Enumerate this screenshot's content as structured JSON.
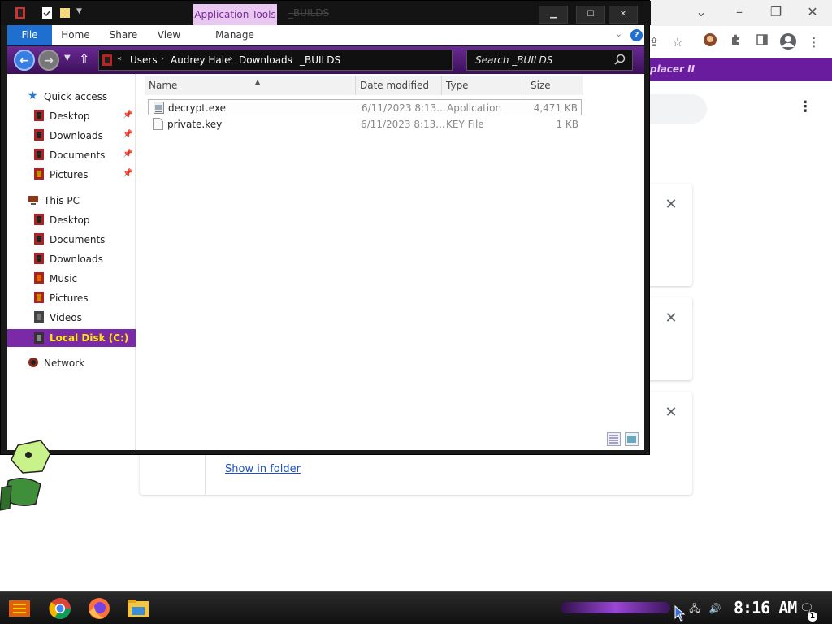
{
  "explorer": {
    "title": "_BUILDS",
    "contextual_tab": "Application Tools",
    "ribbon_tabs": [
      {
        "label": "File"
      },
      {
        "label": "Home"
      },
      {
        "label": "Share"
      },
      {
        "label": "View"
      },
      {
        "label": "Manage"
      }
    ],
    "breadcrumb": [
      "Users",
      "Audrey Hale",
      "Downloads",
      "_BUILDS"
    ],
    "search_placeholder": "Search _BUILDS",
    "nav": {
      "quick_access": {
        "label": "Quick access",
        "items": [
          {
            "label": "Desktop",
            "pinned": true
          },
          {
            "label": "Downloads",
            "pinned": true
          },
          {
            "label": "Documents",
            "pinned": true
          },
          {
            "label": "Pictures",
            "pinned": true
          }
        ]
      },
      "this_pc": {
        "label": "This PC",
        "items": [
          {
            "label": "Desktop"
          },
          {
            "label": "Documents"
          },
          {
            "label": "Downloads"
          },
          {
            "label": "Music"
          },
          {
            "label": "Pictures"
          },
          {
            "label": "Videos"
          },
          {
            "label": "Local Disk (C:)",
            "selected": true
          }
        ]
      },
      "network": {
        "label": "Network"
      }
    },
    "columns": [
      "Name",
      "Date modified",
      "Type",
      "Size"
    ],
    "files": [
      {
        "name": "decrypt.exe",
        "date": "6/11/2023 8:13...",
        "type": "Application",
        "size": "4,471 KB",
        "selected": true,
        "icon": "exe-icon"
      },
      {
        "name": "private.key",
        "date": "6/11/2023 8:13...",
        "type": "KEY File",
        "size": "1 KB",
        "selected": false,
        "icon": "file-icon"
      }
    ]
  },
  "chrome": {
    "bookmark_label": "placer II",
    "download_link": "Show in folder"
  },
  "taskbar": {
    "clock": "8:16 AM",
    "notification_count": "1",
    "apps": [
      "start-icon",
      "chrome-icon",
      "firefox-icon",
      "file-explorer-icon"
    ]
  },
  "colors": {
    "accent_purple": "#7a2aa6",
    "selected_text": "#ffea00",
    "file_tab_blue": "#1f6fd0"
  }
}
